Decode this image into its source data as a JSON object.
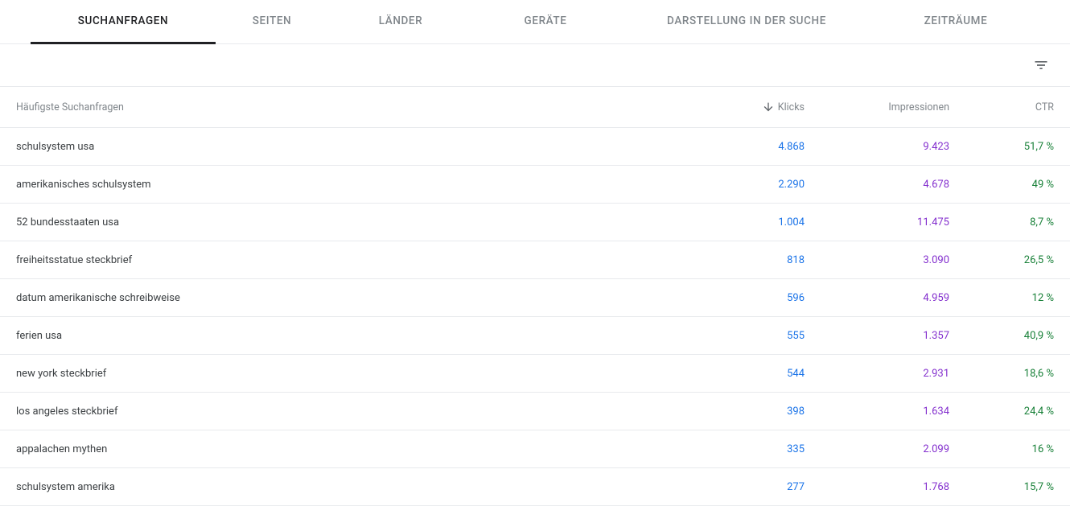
{
  "tabs": {
    "queries": "SUCHANFRAGEN",
    "pages": "SEITEN",
    "countries": "LÄNDER",
    "devices": "GERÄTE",
    "appearance": "DARSTELLUNG IN DER SUCHE",
    "dates": "ZEITRÄUME"
  },
  "headers": {
    "query": "Häufigste Suchanfragen",
    "clicks": "Klicks",
    "impressions": "Impressionen",
    "ctr": "CTR"
  },
  "rows": [
    {
      "query": "schulsystem usa",
      "clicks": "4.868",
      "impressions": "9.423",
      "ctr": "51,7 %"
    },
    {
      "query": "amerikanisches schulsystem",
      "clicks": "2.290",
      "impressions": "4.678",
      "ctr": "49 %"
    },
    {
      "query": "52 bundesstaaten usa",
      "clicks": "1.004",
      "impressions": "11.475",
      "ctr": "8,7 %"
    },
    {
      "query": "freiheitsstatue steckbrief",
      "clicks": "818",
      "impressions": "3.090",
      "ctr": "26,5 %"
    },
    {
      "query": "datum amerikanische schreibweise",
      "clicks": "596",
      "impressions": "4.959",
      "ctr": "12 %"
    },
    {
      "query": "ferien usa",
      "clicks": "555",
      "impressions": "1.357",
      "ctr": "40,9 %"
    },
    {
      "query": "new york steckbrief",
      "clicks": "544",
      "impressions": "2.931",
      "ctr": "18,6 %"
    },
    {
      "query": "los angeles steckbrief",
      "clicks": "398",
      "impressions": "1.634",
      "ctr": "24,4 %"
    },
    {
      "query": "appalachen mythen",
      "clicks": "335",
      "impressions": "2.099",
      "ctr": "16 %"
    },
    {
      "query": "schulsystem amerika",
      "clicks": "277",
      "impressions": "1.768",
      "ctr": "15,7 %"
    }
  ]
}
